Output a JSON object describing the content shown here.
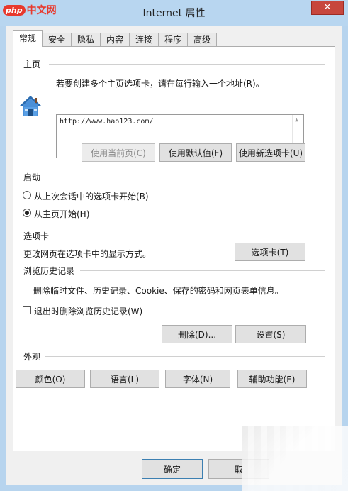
{
  "watermark": {
    "badge": "php",
    "text": "中文网"
  },
  "window": {
    "title": "Internet 属性",
    "close_glyph": "✕"
  },
  "tabs": [
    {
      "label": "常规",
      "active": true
    },
    {
      "label": "安全"
    },
    {
      "label": "隐私"
    },
    {
      "label": "内容"
    },
    {
      "label": "连接"
    },
    {
      "label": "程序"
    },
    {
      "label": "高级"
    }
  ],
  "homepage": {
    "section_label": "主页",
    "instruction": "若要创建多个主页选项卡，请在每行输入一个地址(R)。",
    "url_value": "http://www.hao123.com/",
    "icon": "home-icon",
    "buttons": {
      "use_current": "使用当前页(C)",
      "use_default": "使用默认值(F)",
      "use_new_tab": "使用新选项卡(U)"
    }
  },
  "startup": {
    "section_label": "启动",
    "option_last_session": "从上次会话中的选项卡开始(B)",
    "option_homepage": "从主页开始(H)",
    "selected": "homepage"
  },
  "tabs_section": {
    "section_label": "选项卡",
    "description": "更改网页在选项卡中的显示方式。",
    "button": "选项卡(T)"
  },
  "history": {
    "section_label": "浏览历史记录",
    "description": "删除临时文件、历史记录、Cookie、保存的密码和网页表单信息。",
    "checkbox_label": "退出时删除浏览历史记录(W)",
    "checkbox_checked": false,
    "delete_button": "删除(D)...",
    "settings_button": "设置(S)"
  },
  "appearance": {
    "section_label": "外观",
    "colors_button": "颜色(O)",
    "languages_button": "语言(L)",
    "fonts_button": "字体(N)",
    "accessibility_button": "辅助功能(E)"
  },
  "dialog_buttons": {
    "ok": "确定",
    "cancel": "取"
  },
  "colors": {
    "titlebar": "#b8d6f0",
    "close": "#c7463d",
    "panel": "#ffffff",
    "face": "#f0f0f0"
  }
}
